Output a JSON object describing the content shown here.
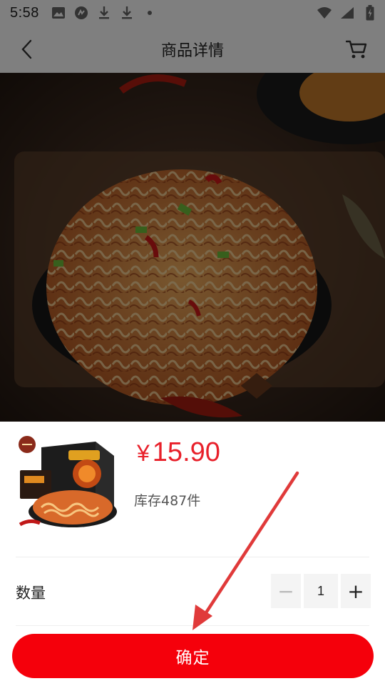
{
  "status_bar": {
    "time": "5:58",
    "left_icons": [
      "image-icon",
      "app-icon",
      "download-icon",
      "download-icon",
      "dot-icon"
    ],
    "right_icons": [
      "wifi-icon",
      "signal-icon",
      "battery-icon"
    ]
  },
  "nav": {
    "title": "商品详情",
    "back_icon": "chevron-left-icon",
    "cart_icon": "cart-icon"
  },
  "sheet": {
    "price_symbol": "¥",
    "price": "15.90",
    "stock": "库存487件",
    "quantity_label": "数量",
    "quantity": "1",
    "minus": "−",
    "plus": "+",
    "confirm": "确定"
  },
  "colors": {
    "accent": "#f5000b",
    "price": "#e8202a",
    "annotation_arrow": "#e03a3a"
  }
}
